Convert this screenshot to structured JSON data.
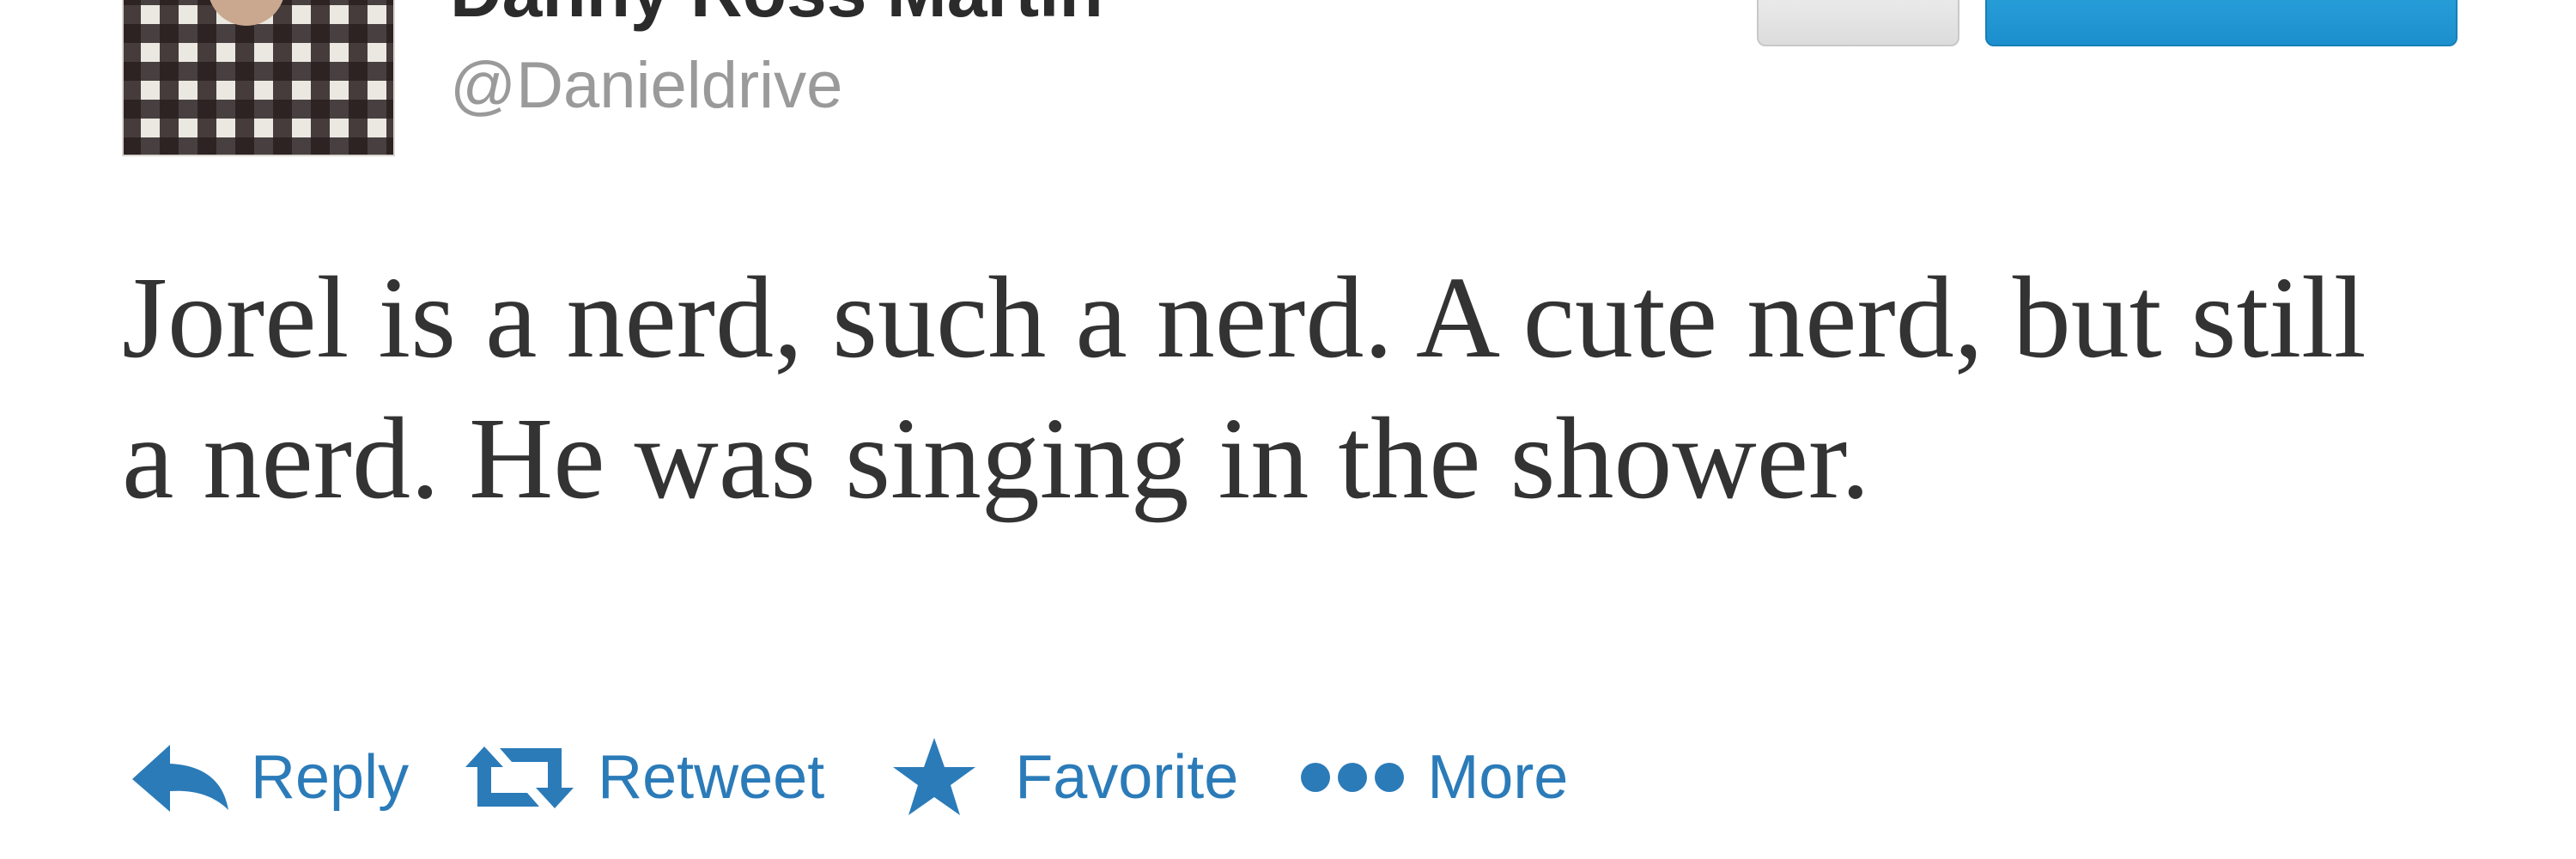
{
  "user": {
    "display_name": "Danny Ross Martin",
    "handle": "@Danieldrive"
  },
  "tweet": {
    "text": "Jorel is a nerd, such a nerd. A cute nerd, but still a nerd. He was singing in the shower."
  },
  "actions": {
    "reply_label": "Reply",
    "retweet_label": "Retweet",
    "favorite_label": "Favorite",
    "more_label": "More"
  },
  "icons": {
    "reply": "reply-arrow-icon",
    "retweet": "retweet-icon",
    "favorite": "star-icon",
    "more": "ellipsis-icon"
  },
  "colors": {
    "action_blue": "#2b7bb9",
    "follow_button_blue": "#1b8fcd",
    "handle_gray": "#9a9a9a",
    "text_dark": "#333333"
  }
}
